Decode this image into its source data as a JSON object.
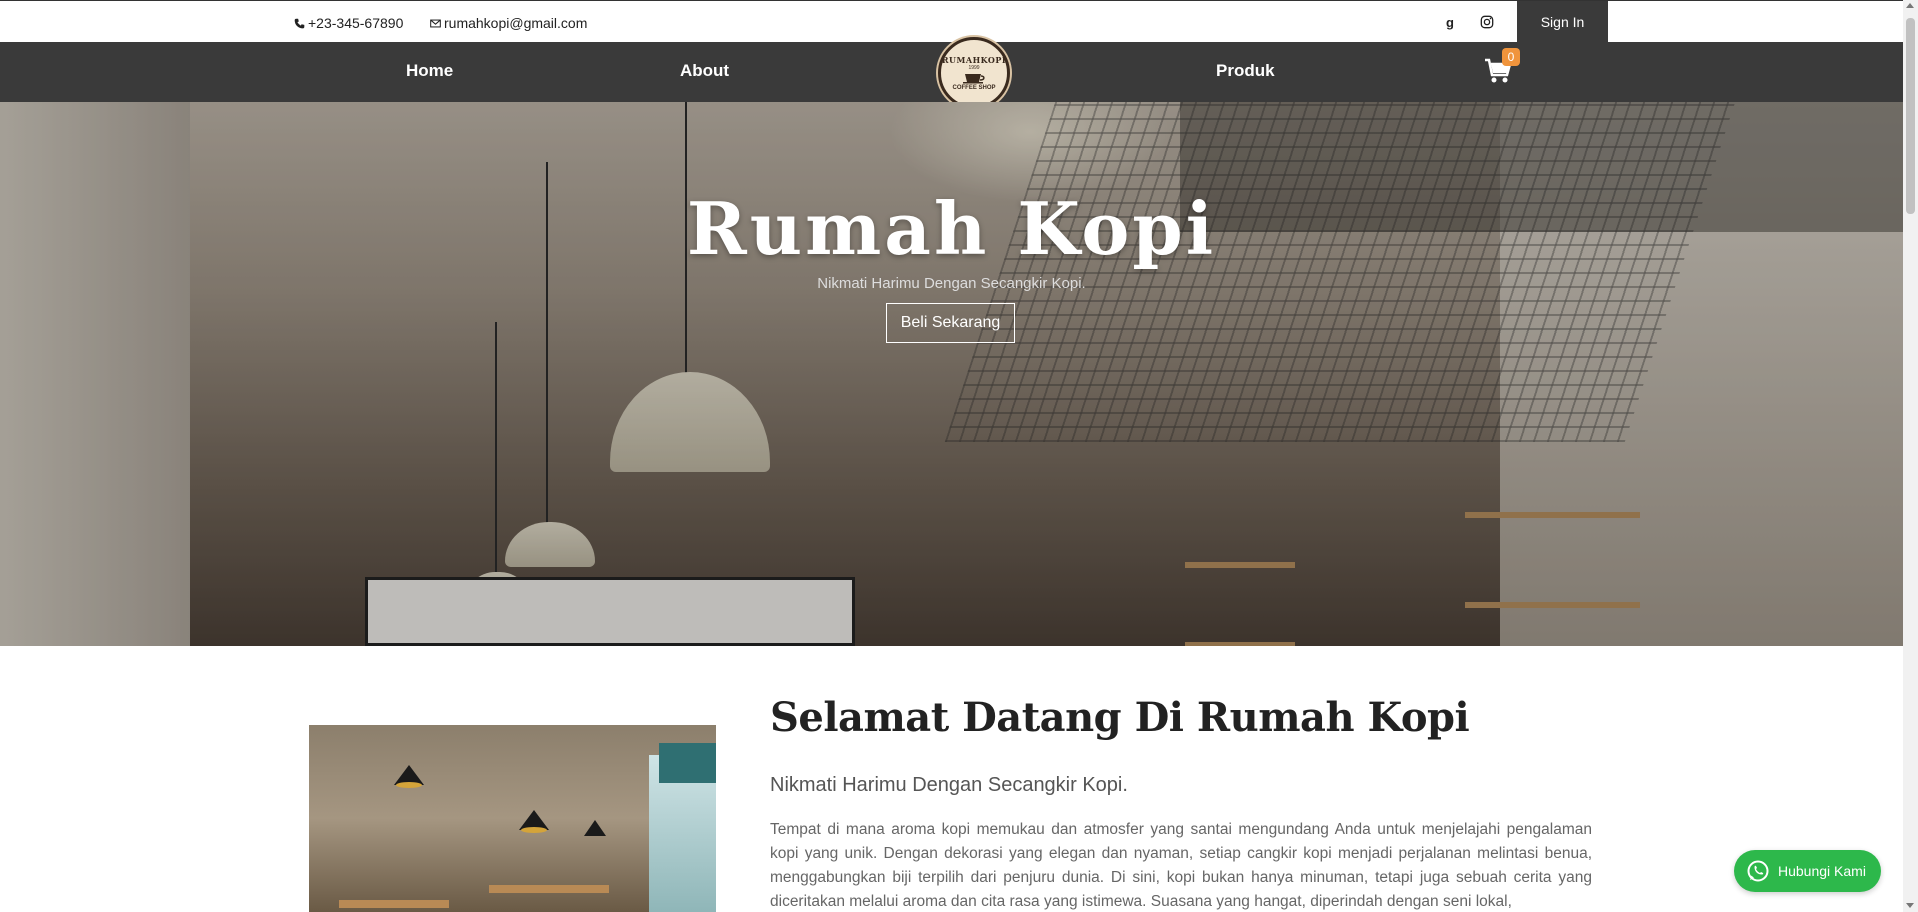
{
  "topbar": {
    "phone": "+23-345-67890",
    "email": "rumahkopi@gmail.com",
    "signin_label": "Sign In"
  },
  "nav": {
    "home": "Home",
    "about": "About",
    "produk": "Produk",
    "cart_count": "0"
  },
  "logo": {
    "top": "RUMAHKOPI",
    "year": "1999",
    "bottom": "COFFEE SHOP"
  },
  "hero": {
    "title": "Rumah Kopi",
    "subtitle": "Nikmati Harimu Dengan Secangkir Kopi.",
    "button": "Beli Sekarang"
  },
  "welcome": {
    "title": "Selamat Datang Di Rumah Kopi",
    "subtitle": "Nikmati Harimu Dengan Secangkir Kopi.",
    "text": "Tempat di mana aroma kopi memukau dan atmosfer yang santai mengundang Anda untuk menjelajahi pengalaman kopi yang unik. Dengan dekorasi yang elegan dan nyaman, setiap cangkir kopi menjadi perjalanan melintasi benua, menggabungkan biji terpilih dari penjuru dunia. Di sini, kopi bukan hanya minuman, tetapi juga sebuah cerita yang diceritakan melalui aroma dan cita rasa yang istimewa. Suasana yang hangat, diperindah dengan seni lokal,"
  },
  "whatsapp": {
    "label": "Hubungi Kami"
  },
  "colors": {
    "nav_bg": "#3a3a3a",
    "cart_badge": "#f0943c",
    "whatsapp": "#2db84b"
  },
  "icons": [
    "phone-icon",
    "mail-icon",
    "google-icon",
    "instagram-icon",
    "cart-icon",
    "whatsapp-icon"
  ]
}
